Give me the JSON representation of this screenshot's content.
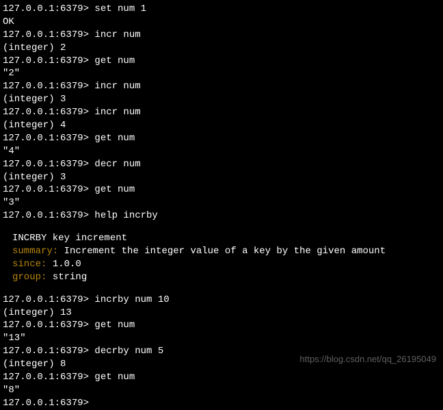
{
  "prompt": "127.0.0.1:6379>",
  "lines": [
    {
      "type": "cmd",
      "text": "set num 1"
    },
    {
      "type": "out",
      "text": "OK"
    },
    {
      "type": "cmd",
      "text": "incr num"
    },
    {
      "type": "out",
      "text": "(integer) 2"
    },
    {
      "type": "cmd",
      "text": "get num"
    },
    {
      "type": "out",
      "text": "\"2\""
    },
    {
      "type": "cmd",
      "text": "incr num"
    },
    {
      "type": "out",
      "text": "(integer) 3"
    },
    {
      "type": "cmd",
      "text": "incr num"
    },
    {
      "type": "out",
      "text": "(integer) 4"
    },
    {
      "type": "cmd",
      "text": "get num"
    },
    {
      "type": "out",
      "text": "\"4\""
    },
    {
      "type": "cmd",
      "text": "decr num"
    },
    {
      "type": "out",
      "text": "(integer) 3"
    },
    {
      "type": "cmd",
      "text": "get num"
    },
    {
      "type": "out",
      "text": "\"3\""
    },
    {
      "type": "cmd",
      "text": "help incrby"
    }
  ],
  "help": {
    "syntax": "INCRBY key increment",
    "summary_label": "summary:",
    "summary_value": "Increment the integer value of a key by the given amount",
    "since_label": "since:",
    "since_value": "1.0.0",
    "group_label": "group:",
    "group_value": "string"
  },
  "lines2": [
    {
      "type": "cmd",
      "text": "incrby num 10"
    },
    {
      "type": "out",
      "text": "(integer) 13"
    },
    {
      "type": "cmd",
      "text": "get num"
    },
    {
      "type": "out",
      "text": "\"13\""
    },
    {
      "type": "cmd",
      "text": "decrby num 5"
    },
    {
      "type": "out",
      "text": "(integer) 8"
    },
    {
      "type": "cmd",
      "text": "get num"
    },
    {
      "type": "out",
      "text": "\"8\""
    },
    {
      "type": "cmd",
      "text": ""
    }
  ],
  "watermark": "https://blog.csdn.net/qq_26195049"
}
